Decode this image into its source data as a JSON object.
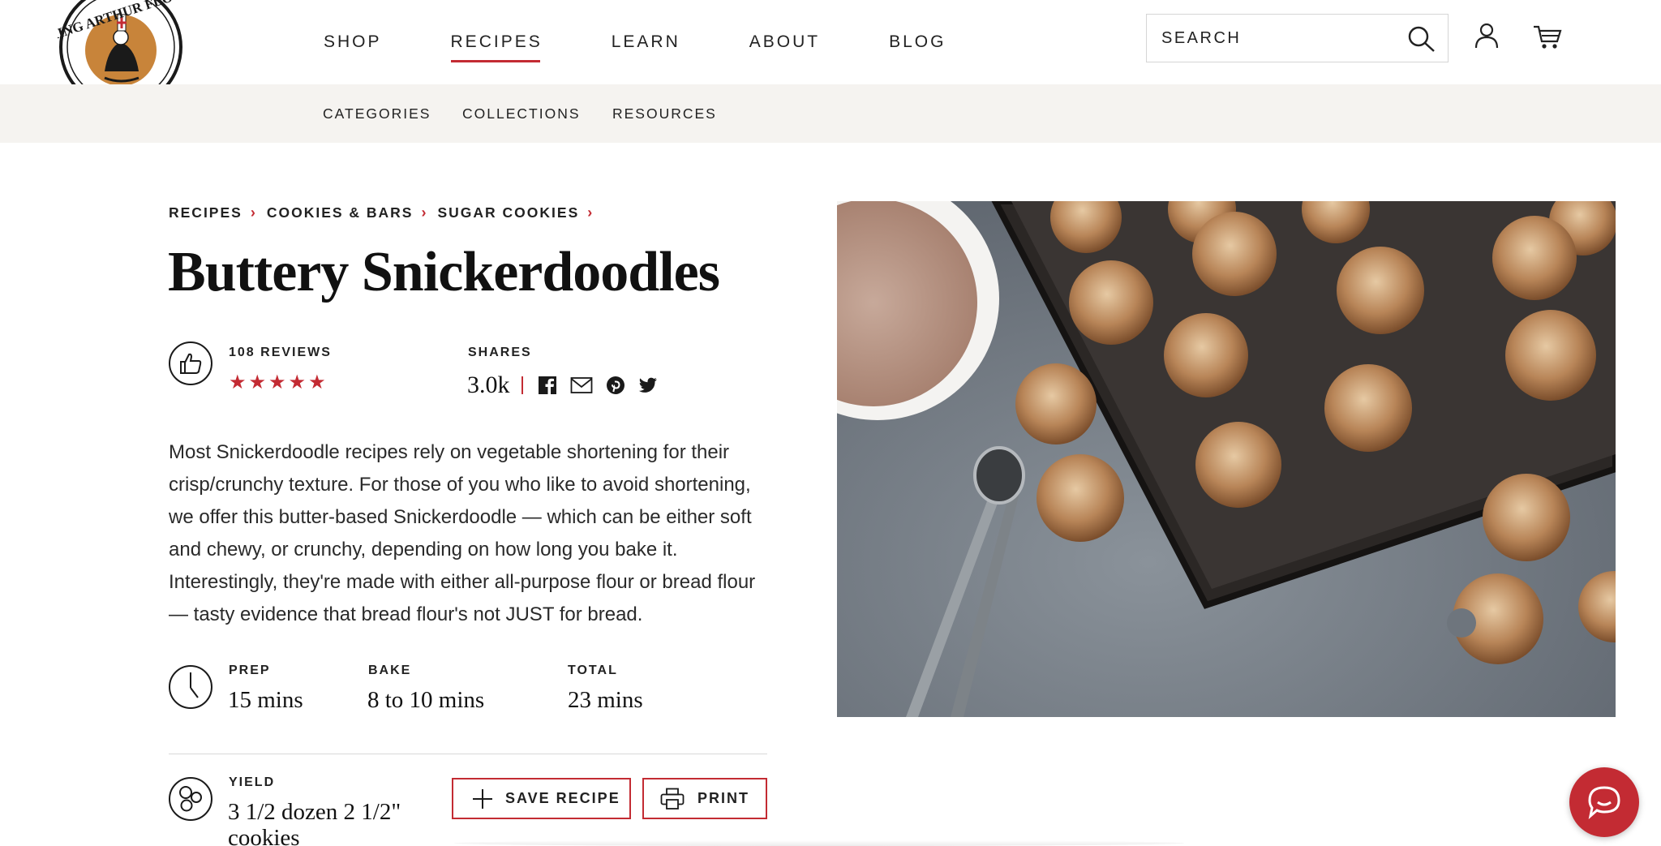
{
  "brand": {
    "name": "King Arthur Flour",
    "logo_text": "KING ARTHUR FLOUR"
  },
  "nav": {
    "items": [
      "SHOP",
      "RECIPES",
      "LEARN",
      "ABOUT",
      "BLOG"
    ],
    "active": "RECIPES"
  },
  "search": {
    "placeholder": "SEARCH"
  },
  "subnav": {
    "items": [
      "CATEGORIES",
      "COLLECTIONS",
      "RESOURCES"
    ]
  },
  "breadcrumb": [
    "RECIPES",
    "COOKIES & BARS",
    "SUGAR COOKIES"
  ],
  "recipe": {
    "title": "Buttery Snickerdoodles",
    "reviews_label": "108 REVIEWS",
    "rating_stars": 5,
    "shares_label": "SHARES",
    "shares_count": "3.0k",
    "description": "Most Snickerdoodle recipes rely on vegetable shortening for their crisp/crunchy texture. For those of you who like to avoid shortening, we offer this butter-based Snickerdoodle — which can be either soft and chewy, or crunchy, depending on how long you bake it. Interestingly, they're made with either all-purpose flour or bread flour — tasty evidence that bread flour's not JUST for bread.",
    "times": {
      "prep_label": "PREP",
      "prep_value": "15 mins",
      "bake_label": "BAKE",
      "bake_value": "8 to 10 mins",
      "total_label": "TOTAL",
      "total_value": "23 mins"
    },
    "yield_label": "YIELD",
    "yield_line1": "3 1/2 dozen 2 1/2\"",
    "yield_line2": "cookies"
  },
  "actions": {
    "save_label": "SAVE RECIPE",
    "print_label": "PRINT"
  },
  "social_icons": [
    "facebook-icon",
    "email-icon",
    "pinterest-icon",
    "twitter-icon"
  ],
  "colors": {
    "accent": "#c32b33",
    "subnav_bg": "#f5f3f0",
    "text": "#1a1a1a"
  }
}
